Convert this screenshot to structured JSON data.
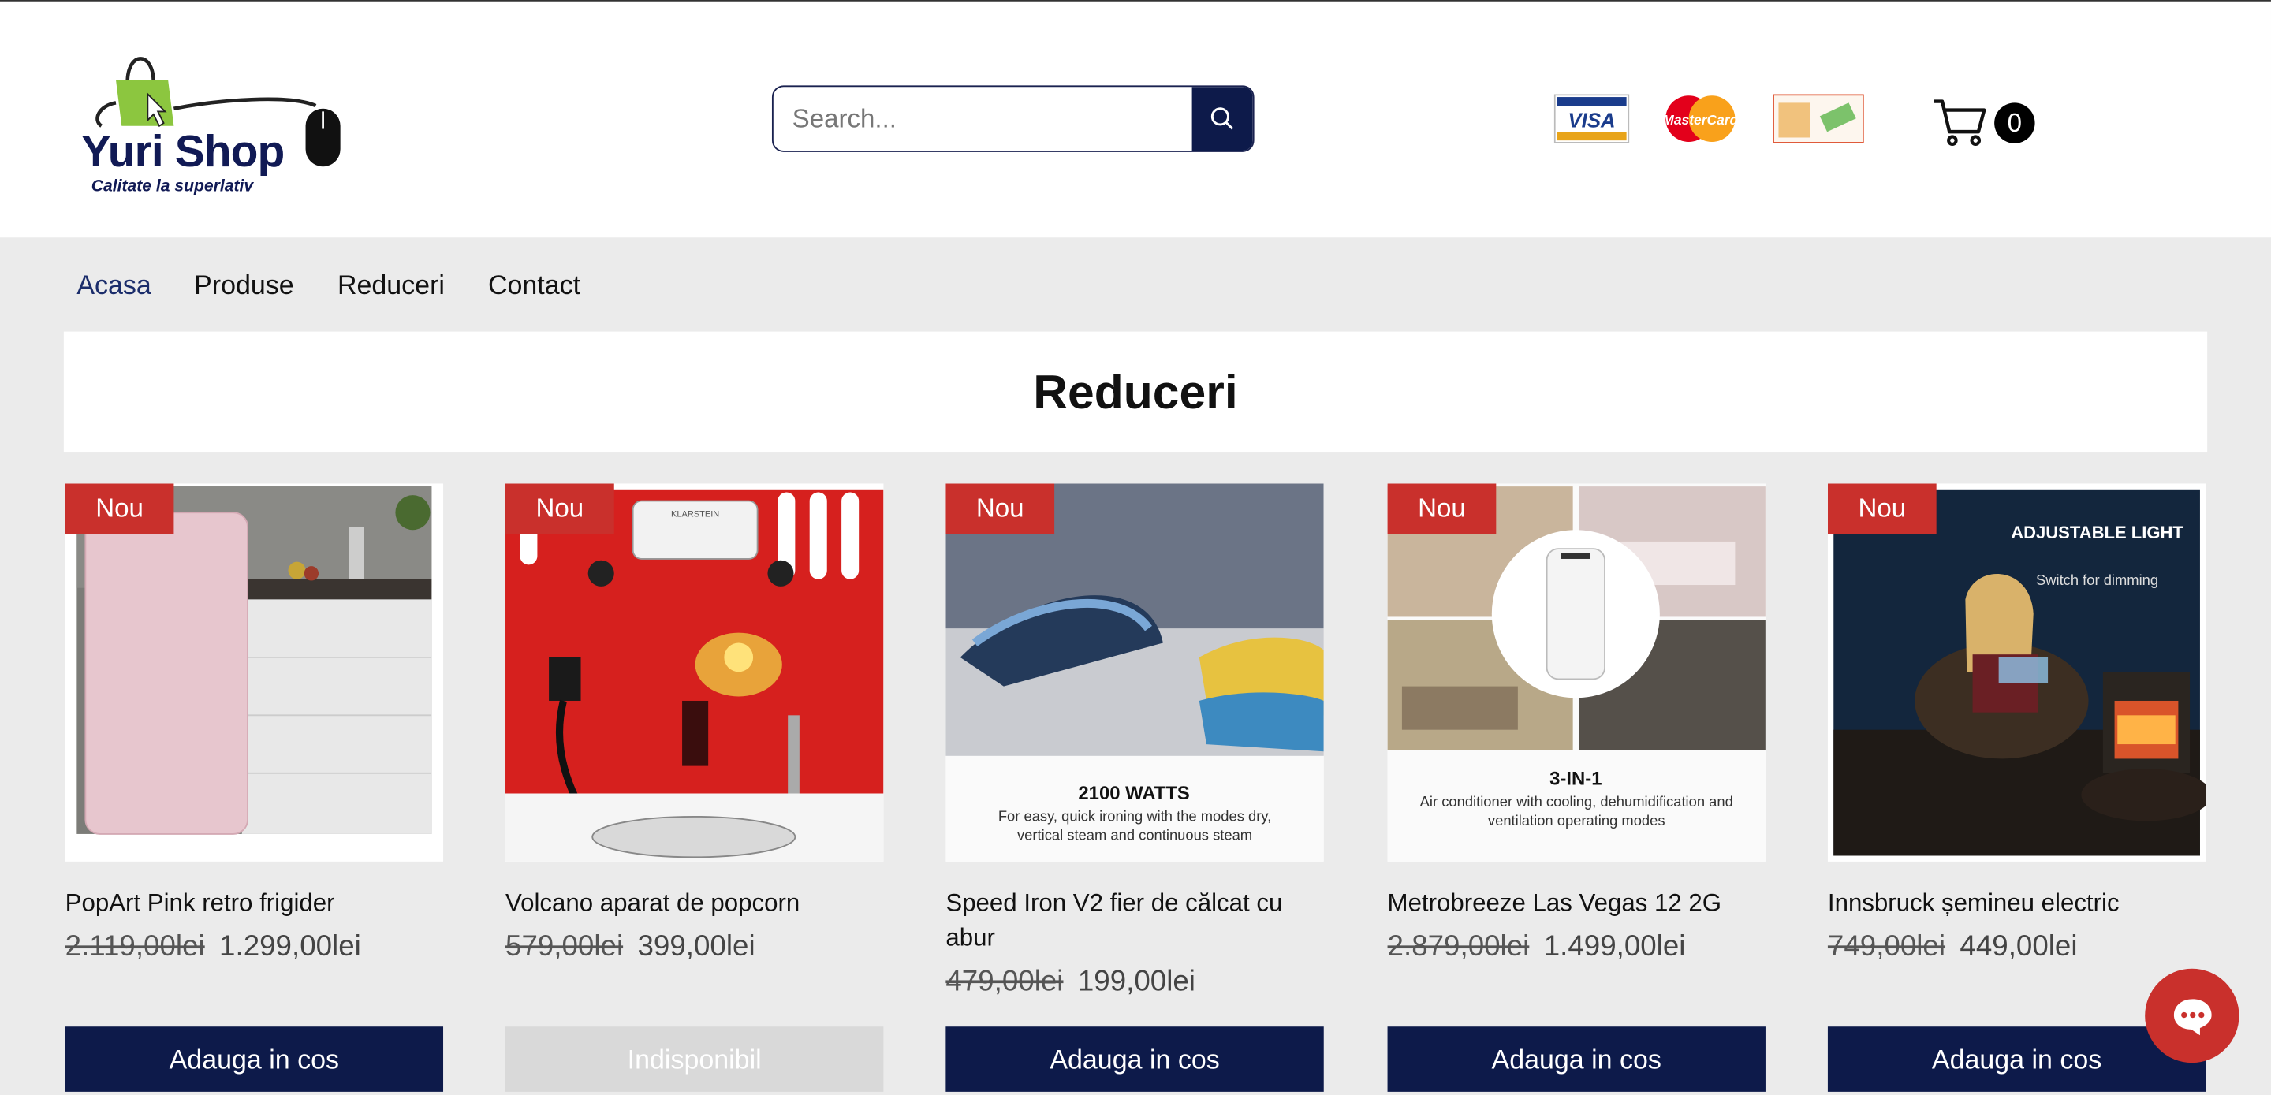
{
  "header": {
    "logo": {
      "name": "Yuri Shop",
      "word1": "Yuri",
      "word2": "Shop",
      "tagline": "Calitate la superlativ"
    },
    "search": {
      "placeholder": "Search...",
      "icon": "search-icon"
    },
    "payment_icons": [
      "visa-icon",
      "mastercard-icon",
      "cash-icon"
    ],
    "payment_labels": {
      "visa": "VISA",
      "mastercard": "MasterCard"
    },
    "cart": {
      "icon": "cart-icon",
      "count": "0"
    }
  },
  "nav": {
    "items": [
      {
        "label": "Acasa",
        "active": true
      },
      {
        "label": "Produse",
        "active": false
      },
      {
        "label": "Reduceri",
        "active": false
      },
      {
        "label": "Contact",
        "active": false
      }
    ]
  },
  "page": {
    "title": "Reduceri"
  },
  "products": [
    {
      "badge": "Nou",
      "name": "PopArt Pink retro frigider",
      "old_price": "2.119,00lei",
      "price": "1.299,00lei",
      "button": "Adauga in cos",
      "available": true,
      "image_text": ""
    },
    {
      "badge": "Nou",
      "name": "Volcano aparat de popcorn",
      "old_price": "579,00lei",
      "price": "399,00lei",
      "button": "Indisponibil",
      "available": false,
      "image_text": "KLARSTEIN"
    },
    {
      "badge": "Nou",
      "name": "Speed Iron V2 fier de călcat cu abur",
      "old_price": "479,00lei",
      "price": "199,00lei",
      "button": "Adauga in cos",
      "available": true,
      "image_text": "2100 WATTS",
      "image_sub": "For easy, quick ironing with the modes dry, vertical steam and continuous steam"
    },
    {
      "badge": "Nou",
      "name": "Metrobreeze Las Vegas 12 2G",
      "old_price": "2.879,00lei",
      "price": "1.499,00lei",
      "button": "Adauga in cos",
      "available": true,
      "image_text": "3-IN-1",
      "image_sub": "Air conditioner with cooling, dehumidification and ventilation operating modes"
    },
    {
      "badge": "Nou",
      "name": "Innsbruck șemineu electric",
      "old_price": "749,00lei",
      "price": "449,00lei",
      "button": "Adauga in cos",
      "available": true,
      "image_text": "ADJUSTABLE LIGHT",
      "image_sub": "Switch for dimming"
    }
  ],
  "chat": {
    "icon": "chat-icon"
  },
  "colors": {
    "navy": "#0d1a4a",
    "badge_red": "#c9302c",
    "bg": "#ebebeb",
    "disabled": "#d9d9d9"
  }
}
